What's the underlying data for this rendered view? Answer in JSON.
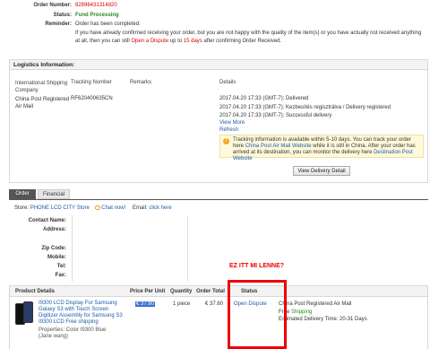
{
  "order": {
    "number_label": "Order Number:",
    "number_value": "82896431314820",
    "status_label": "Status:",
    "status_value": "Fund Processing",
    "reminder_label": "Reminder:",
    "reminder_value": "Order has been completed.",
    "reminder_detail_pre": "If you have already confirmed receiving your order, but you are not happy with the quality of the item(s) or you have actually not received anything at all, then you can still",
    "reminder_link": "Open a Dispute",
    "reminder_up_to": "up to",
    "reminder_days": "15 days",
    "reminder_after": "after confirming Order Received."
  },
  "logistics": {
    "title": "Logistics Information:",
    "headers": [
      "International Shipping Company",
      "Tracking Number",
      "Remarks",
      "Details"
    ],
    "company": "China Post Registered Air Mail",
    "tracking": "RF620400635CN",
    "events": [
      "2017.04.20 17:33 (GMT-7): Delivered",
      "2017.04.20 17:33 (GMT-7): Kezbesítés regisztrálva / Delivery registered",
      "2017.04.20 17:33 (GMT-7): Successful delivery"
    ],
    "view_more": "View More",
    "refresh": "Refresh",
    "notice_pre": "Tracking information is available within 5-10 days. You can track your order here",
    "notice_link1": "China Post Air Mail Website",
    "notice_mid": "while it is still in China. After your order has arrived at its destination, you can monitor the delivery here",
    "notice_link2": "Destination Post Website",
    "view_delivery_button": "View Delivery Detail"
  },
  "tabs": [
    "Order",
    "Financial"
  ],
  "store": {
    "label": "Store:",
    "name": "PHONE LCD CITY Store",
    "chat": "Chat now!",
    "email_label": "Email:",
    "email_link": "click here"
  },
  "contact": {
    "fields": [
      "Contact Name:",
      "Address:",
      "Zip Code:",
      "Mobile:",
      "Tel:",
      "Fax:"
    ]
  },
  "annotation": "EZ ITT MI LENNE?",
  "product": {
    "headers": [
      "Product Details",
      "Price Per Unit",
      "Quantity",
      "Order Total",
      "Status"
    ],
    "name": "I9300 LCD Display For Samsung Galaxy S3 with Touch Screen Digitizer Assembly for Samsung S3 I9300 LCD Free shipping",
    "properties": "Properties: Color I9300 Blue",
    "seller": "(Jane wang)",
    "price": "€ 37.60",
    "quantity": "1 piece",
    "total": "€ 37.60",
    "status_link": "Open Dispute",
    "shipping_company": "China Post Registered Air Mail",
    "shipping_free_pre": "Free",
    "shipping_free_post": "Shipping",
    "delivery_time": "Estimated Delivery Time: 20-31 Days"
  }
}
